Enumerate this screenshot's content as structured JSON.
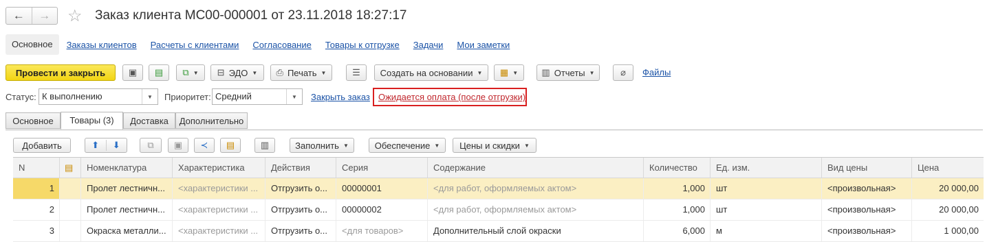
{
  "window": {
    "title": "Заказ клиента МС00-000001 от 23.11.2018 18:27:17",
    "back_icon": "←",
    "forward_icon": "→",
    "favorite_icon": "☆"
  },
  "sections": {
    "active": "Основное",
    "links": [
      "Заказы клиентов",
      "Расчеты с клиентами",
      "Согласование",
      "Товары к отгрузке",
      "Задачи",
      "Мои заметки"
    ]
  },
  "toolbar": {
    "post_close": "Провести и закрыть",
    "edo": "ЭДО",
    "print": "Печать",
    "create_based_on": "Создать на основании",
    "reports": "Отчеты",
    "files": "Файлы"
  },
  "status_bar": {
    "status_label": "Статус:",
    "status_value": "К выполнению",
    "priority_label": "Приоритет:",
    "priority_value": "Средний",
    "close_order": "Закрыть заказ",
    "payment_link": "Ожидается оплата (после отгрузки)"
  },
  "tabs": [
    "Основное",
    "Товары (3)",
    "Доставка",
    "Дополнительно"
  ],
  "table_toolbar": {
    "add": "Добавить",
    "fill": "Заполнить",
    "provision": "Обеспечение",
    "prices": "Цены и скидки"
  },
  "table": {
    "headers": [
      "N",
      "",
      "Номенклатура",
      "Характеристика",
      "Действия",
      "Серия",
      "Содержание",
      "Количество",
      "Ед. изм.",
      "Вид цены",
      "Цена"
    ],
    "rows": [
      [
        "1",
        "",
        "Пролет лестничн...",
        "<характеристики ...",
        "Отгрузить о...",
        "00000001",
        "<для работ, оформляемых актом>",
        "1,000",
        "шт",
        "<произвольная>",
        "20 000,00"
      ],
      [
        "2",
        "",
        "Пролет лестничн...",
        "<характеристики ...",
        "Отгрузить о...",
        "00000002",
        "<для работ, оформляемых актом>",
        "1,000",
        "шт",
        "<произвольная>",
        "20 000,00"
      ],
      [
        "3",
        "",
        "Окраска металли...",
        "<характеристики ...",
        "Отгрузить о...",
        "<для товаров>",
        "Дополнительный слой окраски",
        "6,000",
        "м",
        "<произвольная>",
        "1 000,00"
      ]
    ]
  },
  "colors": {
    "accent_yellow": "#f5d81c",
    "link_blue": "#1a52a6",
    "highlight_red": "#d91f1f",
    "selected_row": "#fbefc3"
  }
}
